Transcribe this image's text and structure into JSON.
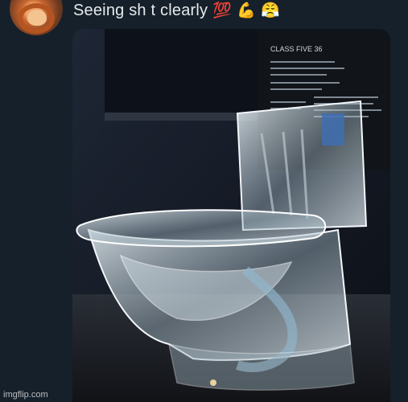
{
  "post": {
    "caption": "Seeing sh t clearly",
    "caption_emojis": [
      "💯",
      "💪",
      "😤"
    ],
    "avatar_icon": "lion-avatar-icon"
  },
  "photo": {
    "sign_title": "CLASS FIVE 36"
  },
  "watermark": {
    "text": "imgflip.com"
  },
  "colors": {
    "background": "#15202b",
    "text": "#e7e9ea",
    "display_sign": "#111418"
  }
}
